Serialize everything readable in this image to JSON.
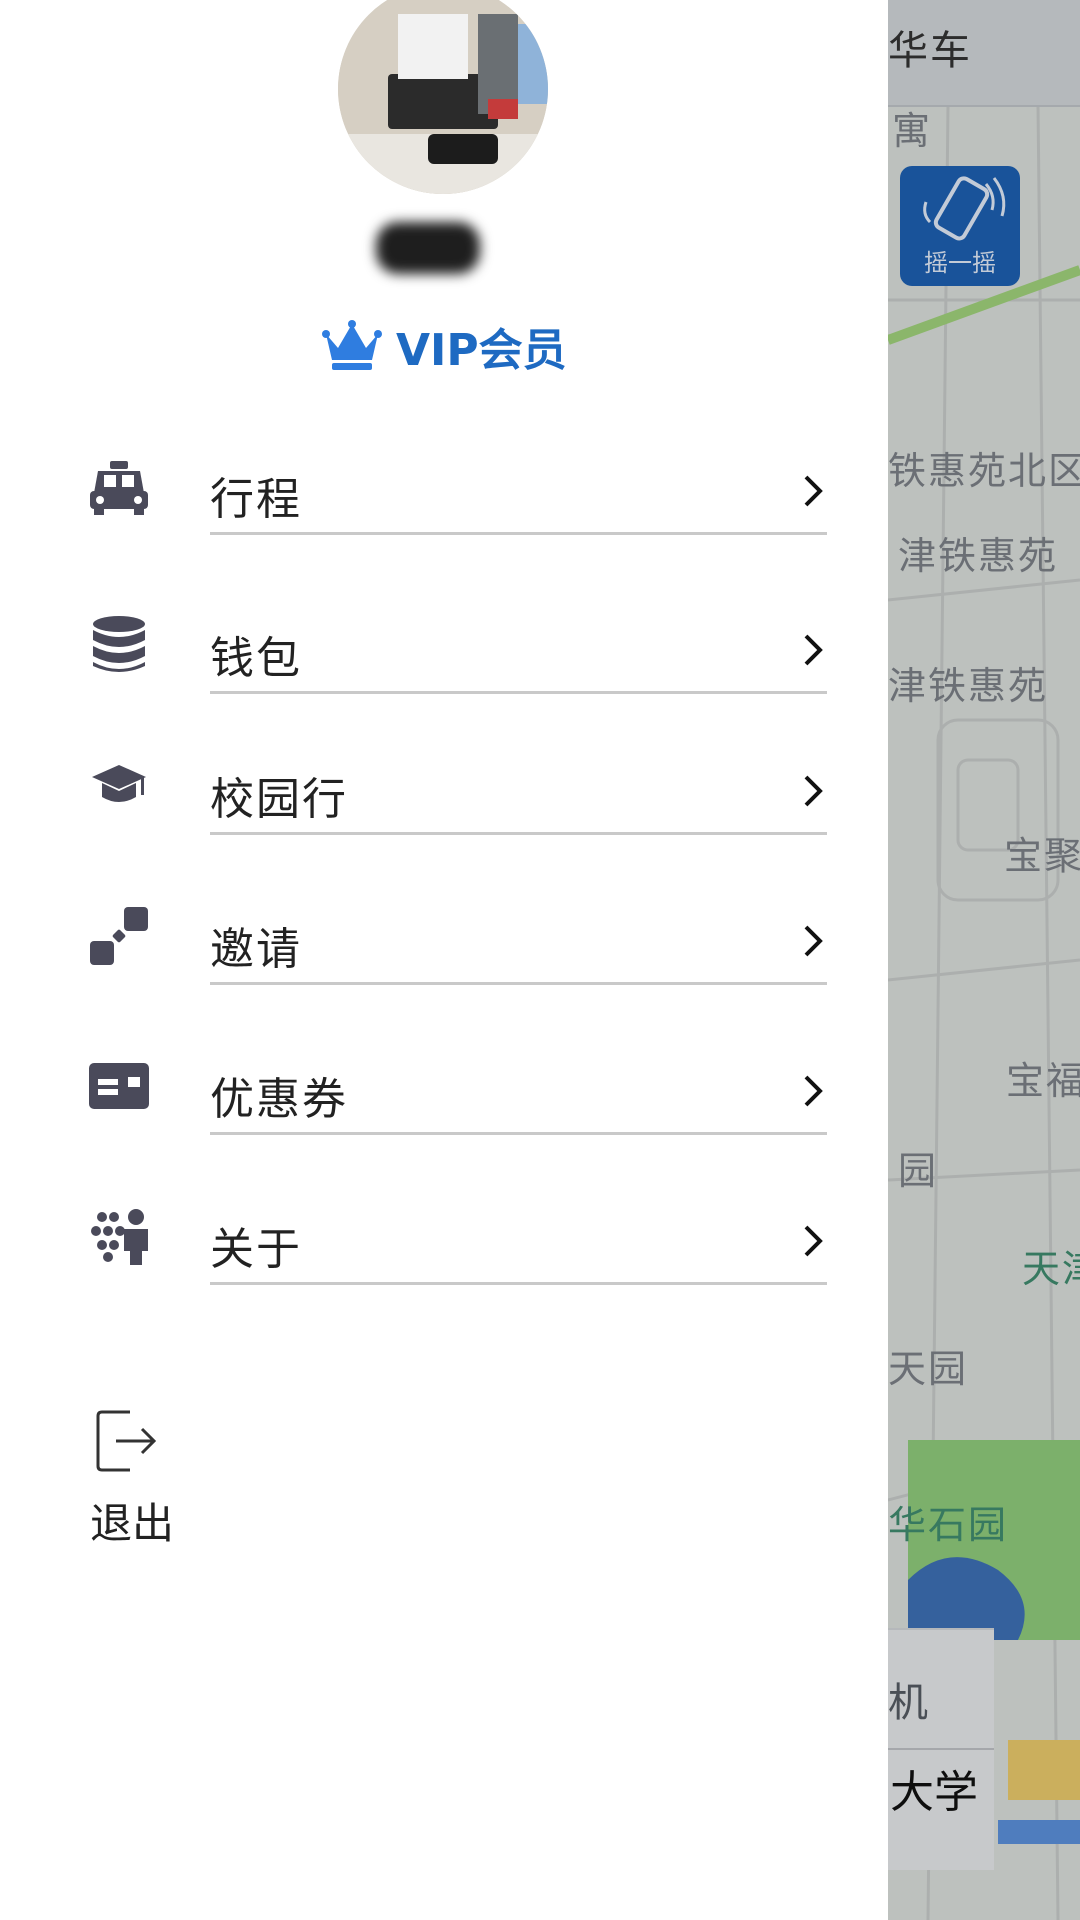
{
  "profile": {
    "vip_label": "VIP会员",
    "crown_color": "#2f7de0",
    "vip_color": "#1e6ac2"
  },
  "menu": {
    "items": [
      {
        "label": "行程",
        "icon": "taxi-icon"
      },
      {
        "label": "钱包",
        "icon": "database-icon"
      },
      {
        "label": "校园行",
        "icon": "graduation-cap-icon"
      },
      {
        "label": "邀请",
        "icon": "nodes-icon"
      },
      {
        "label": "优惠券",
        "icon": "coupon-card-icon"
      },
      {
        "label": "关于",
        "icon": "team-icon"
      }
    ]
  },
  "logout": {
    "label": "退出",
    "icon": "logout-icon"
  },
  "map": {
    "top_text": "华车",
    "labels": [
      "寓",
      "铁惠苑北区",
      "津铁惠苑",
      "津铁惠苑",
      "宝聚",
      "宝福",
      "园",
      "天津",
      "天园",
      "华石园"
    ],
    "shake_label": "摇一摇",
    "panel_row1": "机",
    "panel_row2": "大学"
  }
}
